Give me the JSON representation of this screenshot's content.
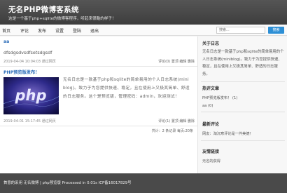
{
  "header": {
    "title": "无名PHP微博客系统",
    "description": "这是一个基于php+sqlite的微博客程序，听起来很酷的样子！"
  },
  "nav": {
    "items": [
      "首页",
      "评论",
      "发布",
      "设置",
      "登陆",
      "退出"
    ]
  },
  "search": {
    "placeholder": "搜索...",
    "button_label": "搜索"
  },
  "posts": [
    {
      "title": "aa",
      "body": "dfsdgsdvsdfsetsdgsdf",
      "date": "2019-04-04 10:04:03 通过网页",
      "actions": "评论(0) 置顶 编辑 删除"
    },
    {
      "title": "PHP预览版发布！",
      "text": "无名日志是一款基于php和sqlite的简单易用的个人日志系统(mini blog)。致力于为您提供快速、稳定，且在使用上又极其简单、舒适的日志服务。这个是预览版，管理密码：admin，欢迎测试！",
      "date": "2019-04-01 15:17:45 通过网页",
      "actions": "评论(1) 置顶 编辑 删除",
      "image_text": "php"
    }
  ],
  "pager": "共计：2 条记录 每页:20条",
  "sidebar": {
    "about_title": "关于日志",
    "about_text": "无名日志是一款基于php和sqlite的简单易用的个人日志系统(miniblog)。致力于为您提供快速、稳定，且在使用上又极其简单、舒适的日志服务。",
    "hot_title": "热评文章",
    "hot_items": [
      "PHP预览版发布！ (1)",
      "aa (0)"
    ],
    "recent_title": "最新评论",
    "recent_items": [
      "网友：淘沉寒评论是一件美德！"
    ],
    "links_title": "友情链接",
    "links_items": [
      "无名的获得"
    ]
  },
  "footer": {
    "text": "首意的采用 无名微博 | php预览版 Processed in 0.01s ICP备16017829号"
  },
  "colors": {
    "header_bg": "#4a4a4a",
    "link_blue": "#2a6cb8",
    "button_blue": "#2d8fd5",
    "footer_bg": "#4a4a4a"
  }
}
